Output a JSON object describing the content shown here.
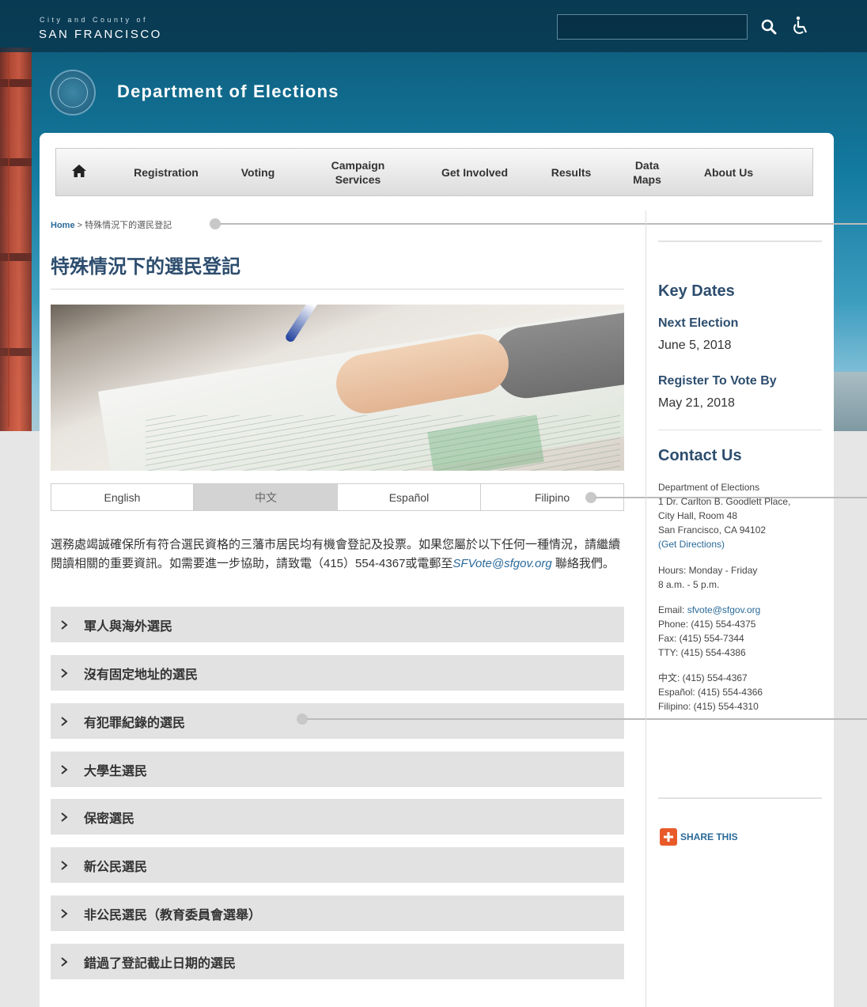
{
  "header": {
    "city_line1": "City and County of",
    "city_line2": "SAN FRANCISCO",
    "department": "Department of Elections",
    "search_value": "",
    "icons": [
      "search-icon",
      "accessibility-icon",
      "city-seal"
    ]
  },
  "nav": {
    "items": [
      {
        "label": "Registration"
      },
      {
        "label": "Voting"
      },
      {
        "label": "Campaign Services"
      },
      {
        "label": "Get Involved"
      },
      {
        "label": "Results"
      },
      {
        "label": "Data Maps"
      },
      {
        "label": "About Us"
      }
    ]
  },
  "breadcrumb": {
    "home": "Home",
    "separator": ">",
    "current": "特殊情況下的選民登記"
  },
  "page": {
    "title": "特殊情況下的選民登記"
  },
  "language_tabs": {
    "items": [
      "English",
      "中文",
      "Español",
      "Filipino"
    ],
    "active": "中文"
  },
  "intro": {
    "text": "選務處竭誠確保所有符合選民資格的三藩市居民均有機會登記及投票。如果您屬於以下任何一種情況，請繼續閱讀相關的重要資訊。如需要進一步協助，請致電（415）554-4367或電郵至",
    "email": "SFVote@sfgov.org",
    "suffix": "聯絡我們。"
  },
  "accordion": [
    "軍人與海外選民",
    "沒有固定地址的選民",
    "有犯罪紀錄的選民",
    "大學生選民",
    "保密選民",
    "新公民選民",
    "非公民選民（教育委員會選舉）",
    "錯過了登記截止日期的選民"
  ],
  "sidebar": {
    "key_dates_title": "Key Dates",
    "next_election_label": "Next Election",
    "next_election_date": "June 5, 2018",
    "register_label": "Register To Vote By",
    "register_date": "May 21, 2018",
    "contact_title": "Contact Us",
    "address": [
      "Department of Elections",
      "1 Dr. Carlton B. Goodlett Place,",
      "City Hall, Room 48",
      "San Francisco, CA 94102"
    ],
    "directions": "(Get Directions)",
    "hours": [
      "Hours: Monday - Friday",
      "8 a.m. - 5 p.m."
    ],
    "email_label": "Email:",
    "email": "sfvote@sfgov.org",
    "phone": "Phone: (415) 554-4375",
    "fax": "Fax: (415) 554-7344",
    "tty": "TTY: (415) 554-4386",
    "chinese": "中文: (415) 554-4367",
    "spanish": "Español: (415) 554-4366",
    "filipino": "Filipino: (415) 554-4310",
    "share": "SHARE THIS"
  },
  "colors": {
    "brand_blue": "#2d4d6e",
    "link_blue": "#2a6a9a",
    "share_orange": "#e85a2a"
  }
}
